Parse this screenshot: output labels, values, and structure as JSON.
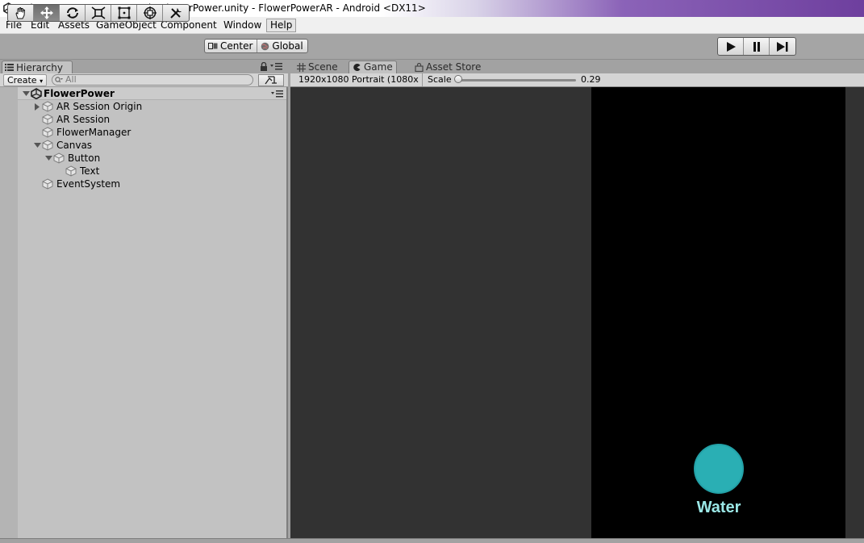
{
  "window": {
    "title": "Unity 2019.1.0a14 Personal - FlowerPower.unity - FlowerPowerAR - Android <DX11>",
    "icon": "unity-logo-icon"
  },
  "menubar": {
    "items": [
      "File",
      "Edit",
      "Assets",
      "GameObject",
      "Component",
      "Window",
      "Help"
    ],
    "active": "Help"
  },
  "toolbar": {
    "tools": [
      "hand-tool-icon",
      "move-tool-icon",
      "rotate-tool-icon",
      "scale-tool-icon",
      "rect-tool-icon",
      "transform-tool-icon",
      "custom-tool-icon"
    ],
    "active_tool": "move-tool-icon",
    "pivot_mode": "Center",
    "pivot_rotation": "Global",
    "play_controls": [
      "play-icon",
      "pause-icon",
      "step-icon"
    ]
  },
  "hierarchy": {
    "tab_label": "Hierarchy",
    "create_label": "Create",
    "search_placeholder": "All",
    "scene_name": "FlowerPower",
    "items": [
      {
        "label": "AR Session Origin",
        "depth": 1,
        "expander": "collapsed"
      },
      {
        "label": "AR Session",
        "depth": 1,
        "expander": "none"
      },
      {
        "label": "FlowerManager",
        "depth": 1,
        "expander": "none"
      },
      {
        "label": "Canvas",
        "depth": 1,
        "expander": "expanded"
      },
      {
        "label": "Button",
        "depth": 2,
        "expander": "expanded"
      },
      {
        "label": "Text",
        "depth": 3,
        "expander": "none"
      },
      {
        "label": "EventSystem",
        "depth": 1,
        "expander": "none"
      }
    ]
  },
  "views": {
    "tabs": [
      "Scene",
      "Game",
      "Asset Store"
    ],
    "active_tab": "Game",
    "resolution": "1920x1080 Portrait (1080x",
    "scale_label": "Scale",
    "scale_value": "0.29",
    "scale_fraction": 0.0
  },
  "game": {
    "button_label": "Water",
    "button_color": "#2aafb4",
    "label_color": "#9be7e6"
  }
}
